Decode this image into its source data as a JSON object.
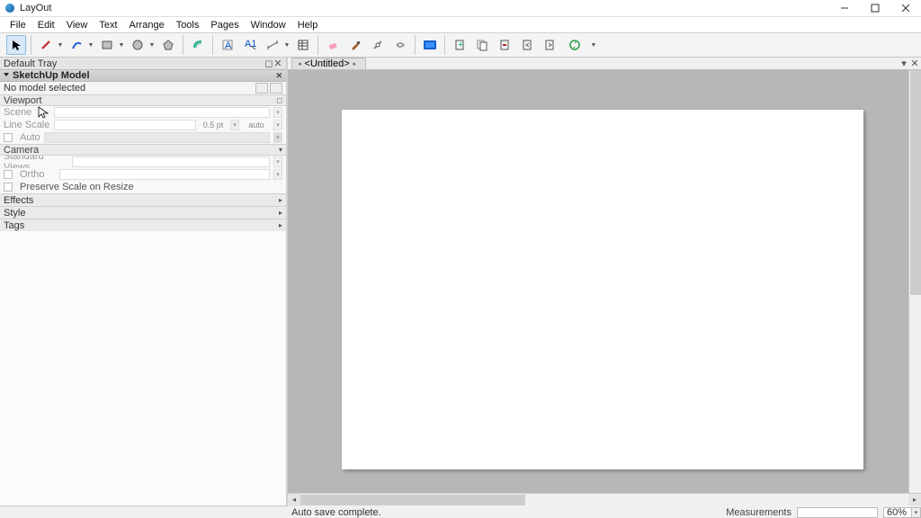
{
  "titlebar": {
    "app_name": "LayOut"
  },
  "menus": [
    "File",
    "Edit",
    "View",
    "Text",
    "Arrange",
    "Tools",
    "Pages",
    "Window",
    "Help"
  ],
  "document": {
    "tab_label": "<Untitled>"
  },
  "tray": {
    "title": "Default Tray",
    "panel": "SketchUp Model",
    "subtitle": "No model selected",
    "viewport": {
      "label": "Viewport",
      "scene": "Scene",
      "line_scale": "Line Scale",
      "line_scale_value": "0.5 pt",
      "line_scale_mode": "auto",
      "auto": "Auto"
    },
    "camera": {
      "label": "Camera",
      "standard_views": "Standard Views",
      "ortho": "Ortho",
      "preserve": "Preserve Scale on Resize"
    },
    "sections": {
      "effects": "Effects",
      "styles": "Style",
      "tags": "Tags"
    }
  },
  "status": {
    "message": "Auto save complete.",
    "measurements_label": "Measurements",
    "zoom": "60%"
  }
}
